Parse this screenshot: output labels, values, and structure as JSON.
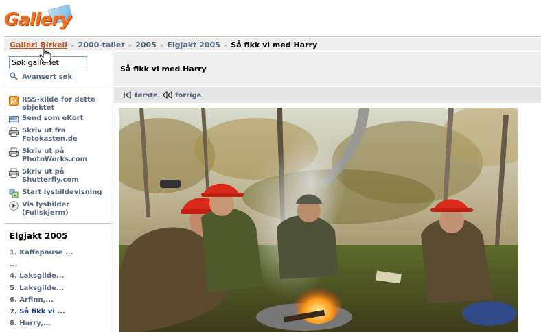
{
  "header": {
    "logo_text": "Gallery"
  },
  "breadcrumb": {
    "items": [
      "Galleri Birkeli",
      "2000-tallet",
      "2005",
      "Elgjakt 2005"
    ],
    "current": "Så fikk vi med Harry"
  },
  "sidebar": {
    "search": {
      "value": "Søk galleriet"
    },
    "advanced_search": "Avansert søk",
    "links": [
      {
        "label": "RSS-kilde for dette objektet",
        "icon": "rss-icon"
      },
      {
        "label": "Send som eKort",
        "icon": "ecard-icon"
      },
      {
        "label": "Skriv ut fra Fotokasten.de",
        "icon": "printer-icon"
      },
      {
        "label": "Skriv ut på PhotoWorks.com",
        "icon": "printer-icon"
      },
      {
        "label": "Skriv ut på Shutterfly.com",
        "icon": "printer-icon"
      },
      {
        "label": "Start lysbildevisning",
        "icon": "slideshow-icon"
      },
      {
        "label": "Vis lysbilder (Fullskjerm)",
        "icon": "play-icon"
      }
    ],
    "album": {
      "title": "Elgjakt 2005",
      "items": [
        "1. Kaffepause ...",
        "...",
        "4. Laksgilde...",
        "5. Laksgilde...",
        "6. Arfinn,...",
        "7. Så fikk vi ...",
        "8. Harry,..."
      ]
    }
  },
  "main": {
    "photo_title": "Så fikk vi med Harry",
    "nav": {
      "first": "første",
      "previous": "forrige"
    }
  },
  "colors": {
    "link": "#52677f",
    "breadcrumb_root": "#c7511b",
    "logo": "#f07020",
    "bar_bg": "#eeeeee"
  }
}
